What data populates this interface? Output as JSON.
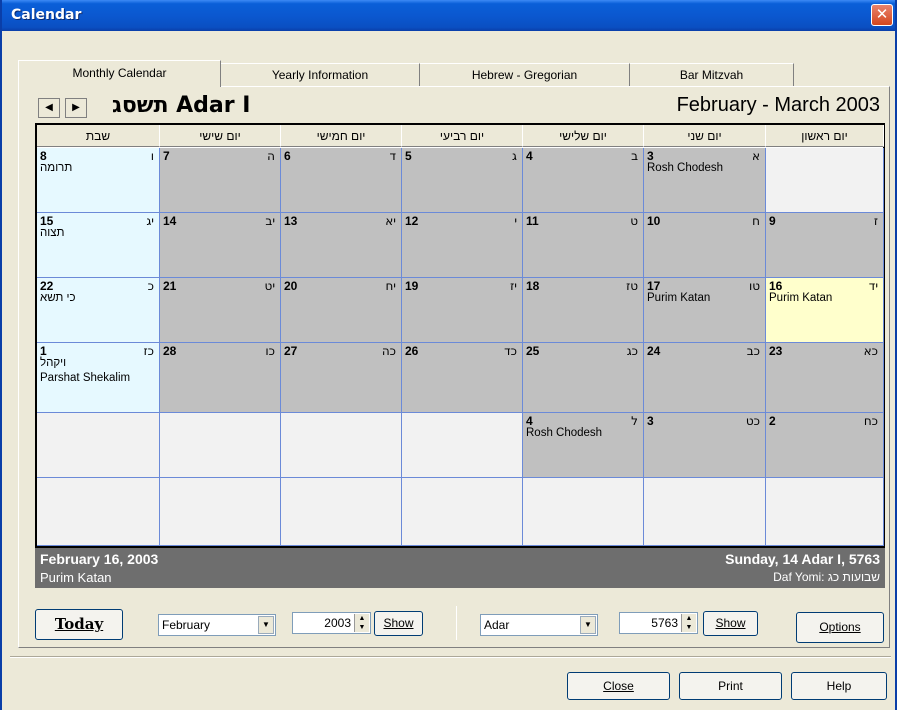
{
  "window": {
    "title": "Calendar",
    "close_glyph": "✕"
  },
  "tabs": [
    {
      "label": "Monthly Calendar"
    },
    {
      "label": "Yearly Information"
    },
    {
      "label": "Hebrew - Gregorian"
    },
    {
      "label": "Bar Mitzvah"
    }
  ],
  "header": {
    "prev_glyph": "◀",
    "next_glyph": "▶",
    "hebrew_month": "תשסג Adar I",
    "gregorian_range": "February  - March 2003"
  },
  "day_headers": [
    "יום ראשון",
    "יום שני",
    "יום שלישי",
    "יום רביעי",
    "יום חמישי",
    "יום שישי",
    "שבת"
  ],
  "weeks": [
    [
      {
        "g": "",
        "h": "",
        "type": "empty",
        "e": []
      },
      {
        "g": "3",
        "h": "א",
        "type": "gray",
        "e": [
          "Rosh Chodesh"
        ]
      },
      {
        "g": "4",
        "h": "ב",
        "type": "gray",
        "e": []
      },
      {
        "g": "5",
        "h": "ג",
        "type": "gray",
        "e": []
      },
      {
        "g": "6",
        "h": "ד",
        "type": "gray",
        "e": []
      },
      {
        "g": "7",
        "h": "ה",
        "type": "gray",
        "e": []
      },
      {
        "g": "8",
        "h": "ו",
        "type": "blue",
        "e": [
          "תרומה"
        ]
      }
    ],
    [
      {
        "g": "9",
        "h": "ז",
        "type": "gray",
        "e": []
      },
      {
        "g": "10",
        "h": "ח",
        "type": "gray",
        "e": []
      },
      {
        "g": "11",
        "h": "ט",
        "type": "gray",
        "e": []
      },
      {
        "g": "12",
        "h": "י",
        "type": "gray",
        "e": []
      },
      {
        "g": "13",
        "h": "יא",
        "type": "gray",
        "e": []
      },
      {
        "g": "14",
        "h": "יב",
        "type": "gray",
        "e": []
      },
      {
        "g": "15",
        "h": "יג",
        "type": "blue",
        "e": [
          "תצוה"
        ]
      }
    ],
    [
      {
        "g": "16",
        "h": "יד",
        "type": "yellow",
        "e": [
          "Purim Katan"
        ]
      },
      {
        "g": "17",
        "h": "טו",
        "type": "gray",
        "e": [
          "Purim Katan"
        ]
      },
      {
        "g": "18",
        "h": "טז",
        "type": "gray",
        "e": []
      },
      {
        "g": "19",
        "h": "יז",
        "type": "gray",
        "e": []
      },
      {
        "g": "20",
        "h": "יח",
        "type": "gray",
        "e": []
      },
      {
        "g": "21",
        "h": "יט",
        "type": "gray",
        "e": []
      },
      {
        "g": "22",
        "h": "כ",
        "type": "blue",
        "e": [
          "כי תשא"
        ]
      }
    ],
    [
      {
        "g": "23",
        "h": "כא",
        "type": "gray",
        "e": []
      },
      {
        "g": "24",
        "h": "כב",
        "type": "gray",
        "e": []
      },
      {
        "g": "25",
        "h": "כג",
        "type": "gray",
        "e": []
      },
      {
        "g": "26",
        "h": "כד",
        "type": "gray",
        "e": []
      },
      {
        "g": "27",
        "h": "כה",
        "type": "gray",
        "e": []
      },
      {
        "g": "28",
        "h": "כו",
        "type": "gray",
        "e": []
      },
      {
        "g": "1",
        "h": "כז",
        "type": "blue",
        "e": [
          "ויקהל",
          "Parshat Shekalim"
        ]
      }
    ],
    [
      {
        "g": "2",
        "h": "כח",
        "type": "gray",
        "e": []
      },
      {
        "g": "3",
        "h": "כט",
        "type": "gray",
        "e": []
      },
      {
        "g": "4",
        "h": "ל",
        "type": "gray",
        "e": [
          "Rosh Chodesh"
        ]
      },
      {
        "g": "",
        "h": "",
        "type": "empty",
        "e": []
      },
      {
        "g": "",
        "h": "",
        "type": "empty",
        "e": []
      },
      {
        "g": "",
        "h": "",
        "type": "empty",
        "e": []
      },
      {
        "g": "",
        "h": "",
        "type": "empty",
        "e": []
      }
    ],
    [
      {
        "g": "",
        "h": "",
        "type": "empty",
        "e": []
      },
      {
        "g": "",
        "h": "",
        "type": "empty",
        "e": []
      },
      {
        "g": "",
        "h": "",
        "type": "empty",
        "e": []
      },
      {
        "g": "",
        "h": "",
        "type": "empty",
        "e": []
      },
      {
        "g": "",
        "h": "",
        "type": "empty",
        "e": []
      },
      {
        "g": "",
        "h": "",
        "type": "empty",
        "e": []
      },
      {
        "g": "",
        "h": "",
        "type": "empty",
        "e": []
      }
    ]
  ],
  "status": {
    "gregorian_date": "February 16, 2003",
    "event": "Purim Katan",
    "hebrew_date": "Sunday, 14 Adar I, 5763",
    "daf_yomi": "Daf Yomi: שבועות כג"
  },
  "controls": {
    "today_label": "Today",
    "greg_month": "February",
    "greg_year": "2003",
    "show1_label": "Show",
    "heb_month": "Adar",
    "heb_year": "5763",
    "show2_label": "Show",
    "options_label": "Options",
    "dropdown_arrow": "▼",
    "spin_up": "▲",
    "spin_down": "▼"
  },
  "footer": {
    "close_label": "Close",
    "print_label": "Print",
    "help_label": "Help"
  }
}
